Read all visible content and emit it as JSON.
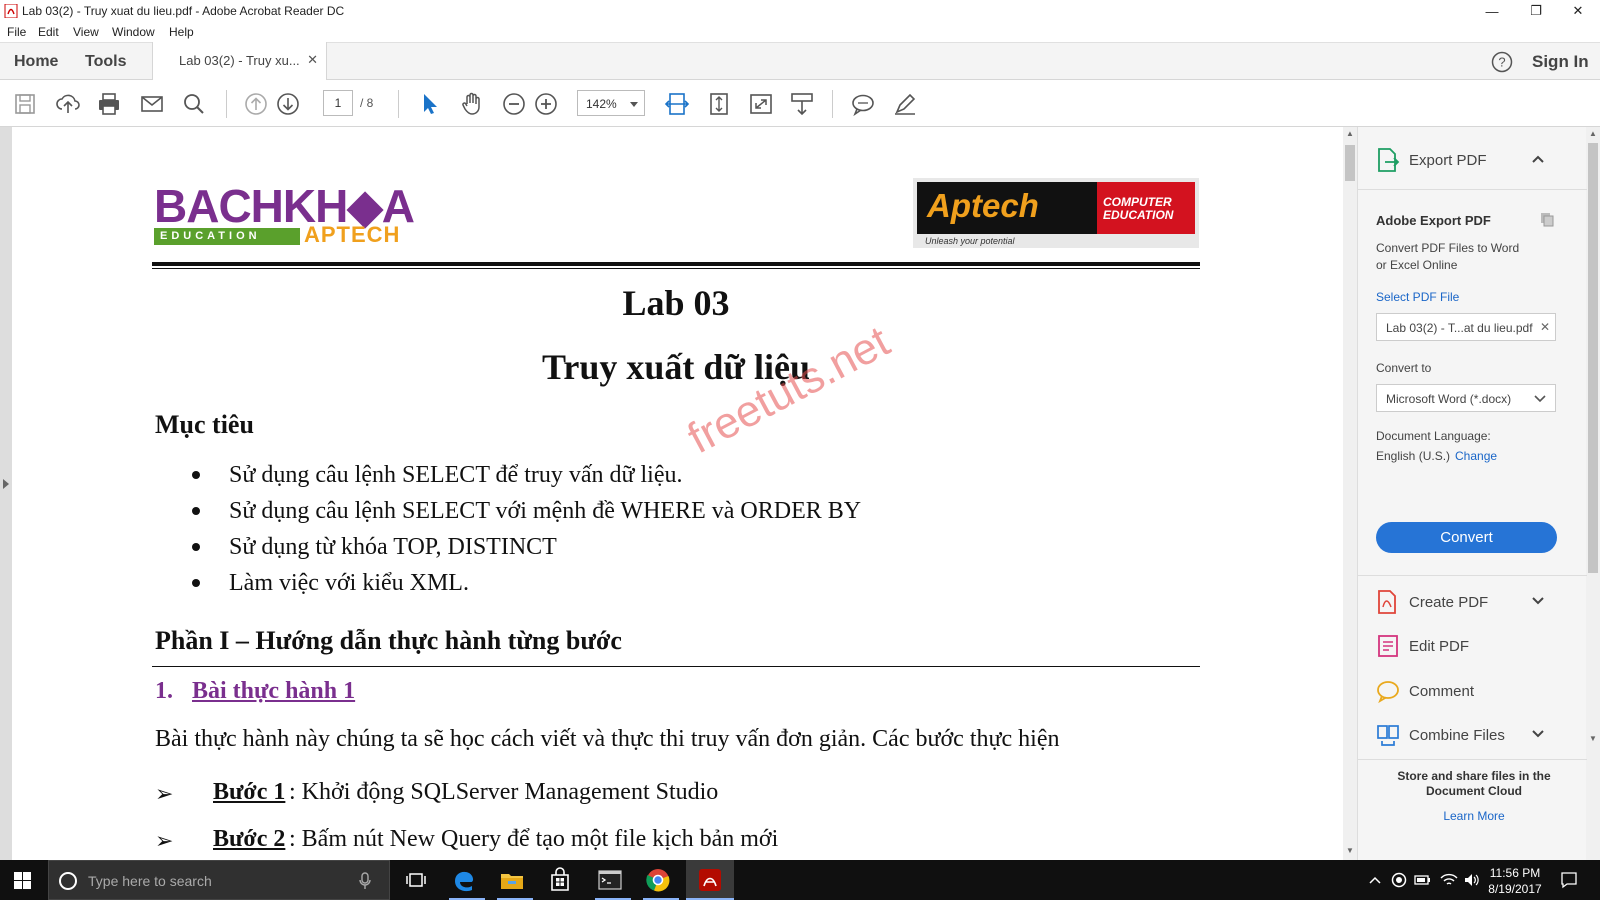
{
  "window": {
    "title": "Lab 03(2) - Truy xuat du lieu.pdf - Adobe Acrobat Reader DC",
    "minimize_glyph": "—",
    "maximize_glyph": "❐",
    "close_glyph": "✕"
  },
  "menu": [
    "File",
    "Edit",
    "View",
    "Window",
    "Help"
  ],
  "tabs": {
    "home": "Home",
    "tools": "Tools",
    "document": "Lab 03(2) - Truy xu...",
    "close_glyph": "✕",
    "sign_in": "Sign In"
  },
  "toolbar": {
    "page_current": "1",
    "page_total": "/ 8",
    "zoom": "142%"
  },
  "document": {
    "logo_left": {
      "main": "BACHKH◆A",
      "education": "EDUCATION",
      "aptech": "APTECH"
    },
    "logo_right": {
      "word": "Aptech",
      "line1": "COMPUTER",
      "line2": "EDUCATION",
      "tagline": "Unleash your potential"
    },
    "title": "Lab 03",
    "subtitle": "Truy xuất dữ liệu",
    "objectives_heading": "Mục tiêu",
    "objectives": [
      "Sử dụng câu lệnh SELECT để truy vấn dữ liệu.",
      "Sử dụng câu lệnh SELECT với mệnh đề WHERE và ORDER BY",
      "Sử dụng từ khóa TOP, DISTINCT",
      "Làm việc với kiểu XML."
    ],
    "part1_heading": "Phần I – Hướng dẫn thực hành từng bước",
    "exercise_number": "1.",
    "exercise_title": "Bài thực hành 1",
    "intro": "Bài thực hành này chúng ta sẽ học cách viết và thực thi truy vấn đơn giản. Các bước thực hiện",
    "steps": [
      {
        "arrow": "➢",
        "label": "Bước 1",
        "text": ": Khởi động SQLServer Management Studio"
      },
      {
        "arrow": "➢",
        "label": "Bước 2",
        "text": ": Bấm nút New Query để tạo một file kịch bản mới"
      }
    ],
    "watermark": "freetuts.net"
  },
  "right_panel": {
    "export_pdf": "Export PDF",
    "adobe_export_title": "Adobe Export PDF",
    "convert_desc_1": "Convert PDF Files to Word",
    "convert_desc_2": "or Excel Online",
    "select_pdf": "Select PDF File",
    "file_name": "Lab 03(2) - T...at du lieu.pdf",
    "file_clear": "✕",
    "convert_to_label": "Convert to",
    "convert_to_value": "Microsoft Word (*.docx)",
    "doc_language_label": "Document Language:",
    "doc_language_value": "English (U.S.)",
    "change": "Change",
    "convert_button": "Convert",
    "create_pdf": "Create PDF",
    "edit_pdf": "Edit PDF",
    "comment": "Comment",
    "combine_files": "Combine Files",
    "cloud_line1": "Store and share files in the",
    "cloud_line2": "Document Cloud",
    "learn_more": "Learn More",
    "accent_color": "#2674d6"
  },
  "taskbar": {
    "search_placeholder": "Type here to search",
    "time": "11:56 PM",
    "date": "8/19/2017"
  }
}
